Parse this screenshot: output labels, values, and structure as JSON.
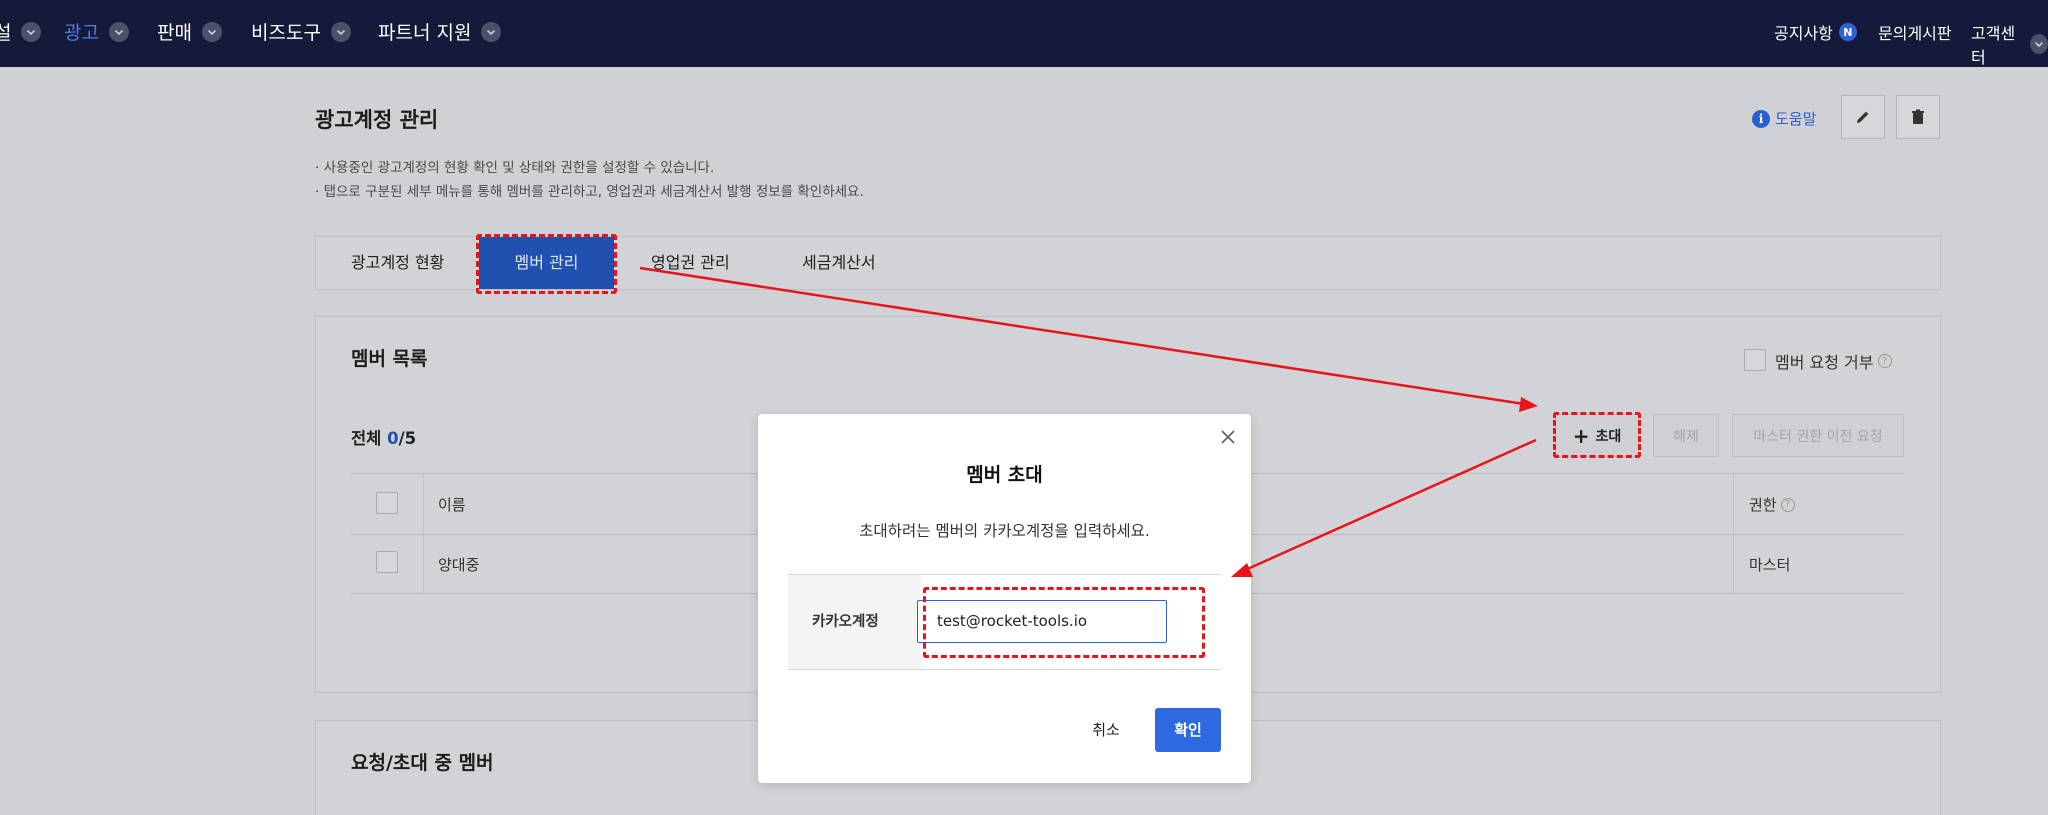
{
  "topnav": {
    "items": [
      {
        "label": "설"
      },
      {
        "label": "광고"
      },
      {
        "label": "판매"
      },
      {
        "label": "비즈도구"
      },
      {
        "label": "파트너 지원"
      }
    ],
    "right": {
      "notice": "공지사항",
      "notice_badge": "N",
      "board": "문의게시판",
      "support": "고객센터"
    }
  },
  "page": {
    "title": "광고계정 관리",
    "desc1": "사용중인 광고계정의 현황 확인 및 상태와 권한을 설정할 수 있습니다.",
    "desc2": "탭으로 구분된 세부 메뉴를 통해 멤버를 관리하고, 영업권과 세금계산서 발행 정보를 확인하세요.",
    "help": "도움말",
    "help_icon": "i"
  },
  "tabs": [
    {
      "label": "광고계정 현황"
    },
    {
      "label": "멤버 관리"
    },
    {
      "label": "영업권 관리"
    },
    {
      "label": "세금계산서"
    }
  ],
  "members": {
    "title": "멤버 목록",
    "reject_label": "멤버 요청 거부",
    "total_label": "전체",
    "total_count": "0",
    "total_max": "/5",
    "invite_label": "초대",
    "release_label": "해제",
    "transfer_label": "마스터 권한 이전 요청",
    "columns": {
      "name": "이름",
      "role": "권한"
    },
    "rows": [
      {
        "name": "양대중",
        "role": "마스터"
      }
    ]
  },
  "pending": {
    "title": "요청/초대 중 멤버"
  },
  "modal": {
    "title": "멤버 초대",
    "desc": "초대하려는 멤버의 카카오계정을 입력하세요.",
    "field_label": "카카오계정",
    "field_value": "test@rocket-tools.io",
    "cancel": "취소",
    "ok": "확인"
  },
  "colors": {
    "nav_bg": "#151a3b",
    "accent": "#2d6ae0",
    "annotation": "#e8141c"
  }
}
